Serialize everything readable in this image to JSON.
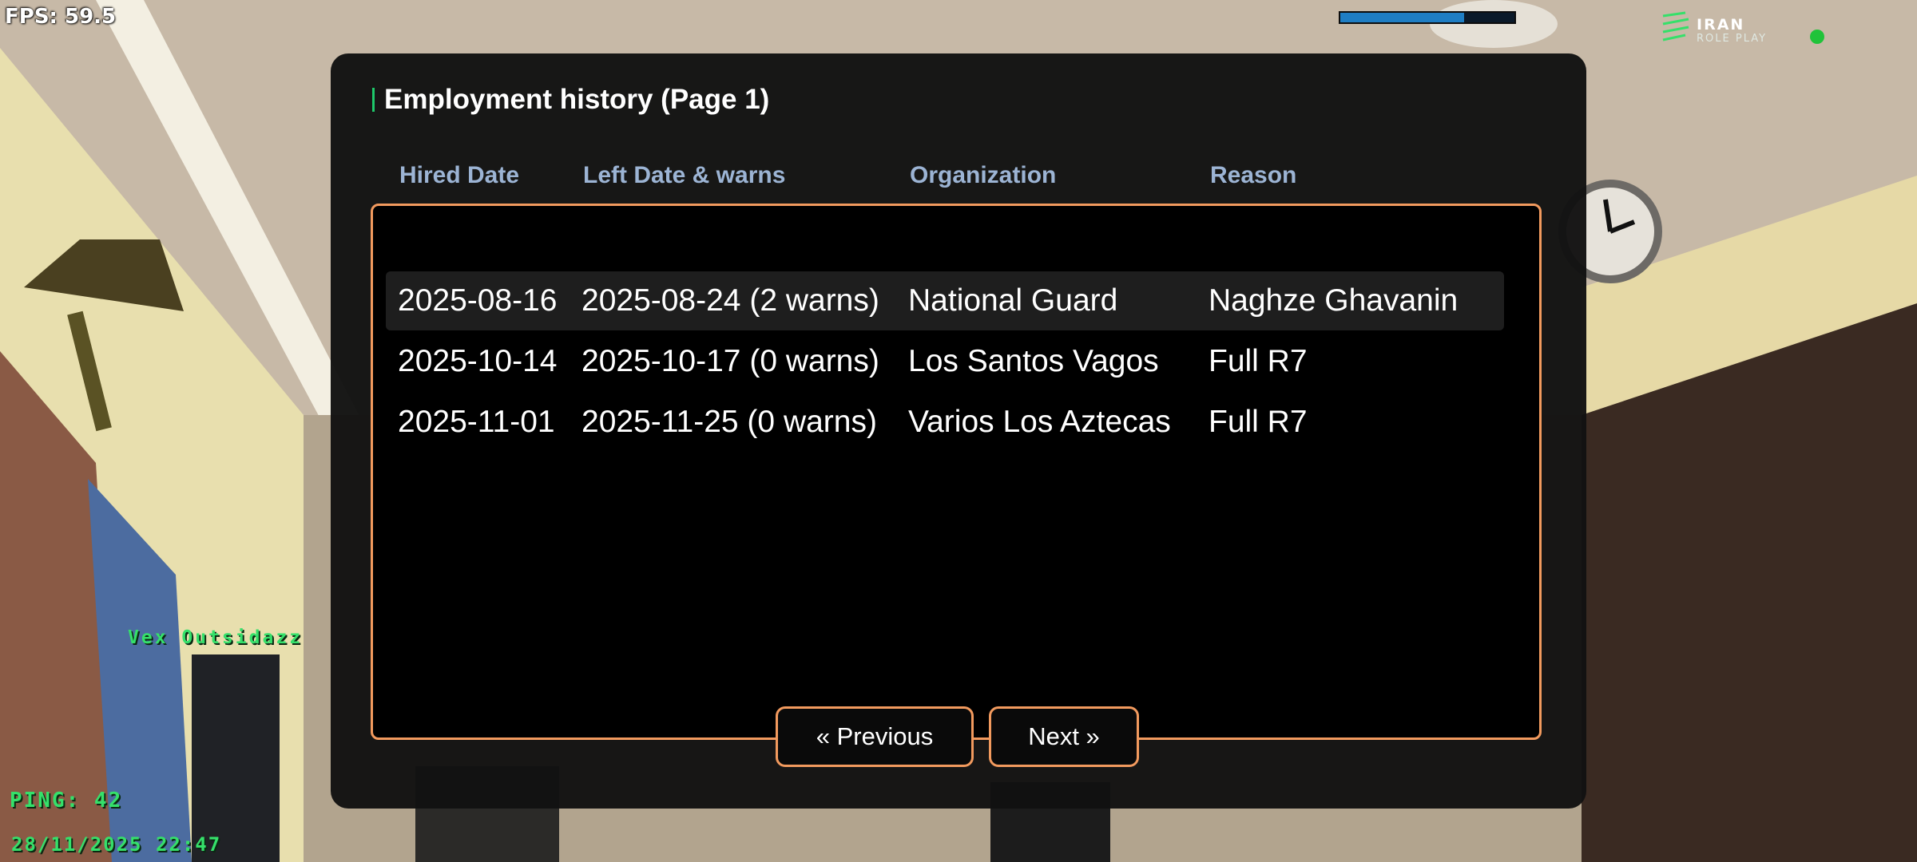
{
  "hud": {
    "fps": "FPS: 59.5",
    "health_fraction": 0.71,
    "logo_line1": "IRAN",
    "logo_line2": "ROLE PLAY",
    "nametag": "Vex Outsidazz",
    "ping": "PING: 42",
    "datetime": "28/11/2025 22:47"
  },
  "dialog": {
    "title": "Employment history (Page 1)",
    "columns": [
      "Hired Date",
      "Left Date & warns",
      "Organization",
      "Reason"
    ],
    "rows": [
      [
        "2025-08-16",
        "2025-08-24 (2 warns)",
        "National Guard",
        "Naghze Ghavanin"
      ],
      [
        "2025-10-14",
        "2025-10-17 (0 warns)",
        "Los Santos Vagos",
        "Full R7"
      ],
      [
        "2025-11-01",
        "2025-11-25 (0 warns)",
        "Varios Los Aztecas",
        "Full R7"
      ]
    ],
    "previous_label": "« Previous",
    "next_label": "Next »"
  },
  "colors": {
    "accent_border": "#f29a5e",
    "header_text": "#9cb4d4",
    "title_accent": "#1ec86a",
    "hud_green": "#35e06a",
    "health_fill": "#1f7ec4"
  }
}
